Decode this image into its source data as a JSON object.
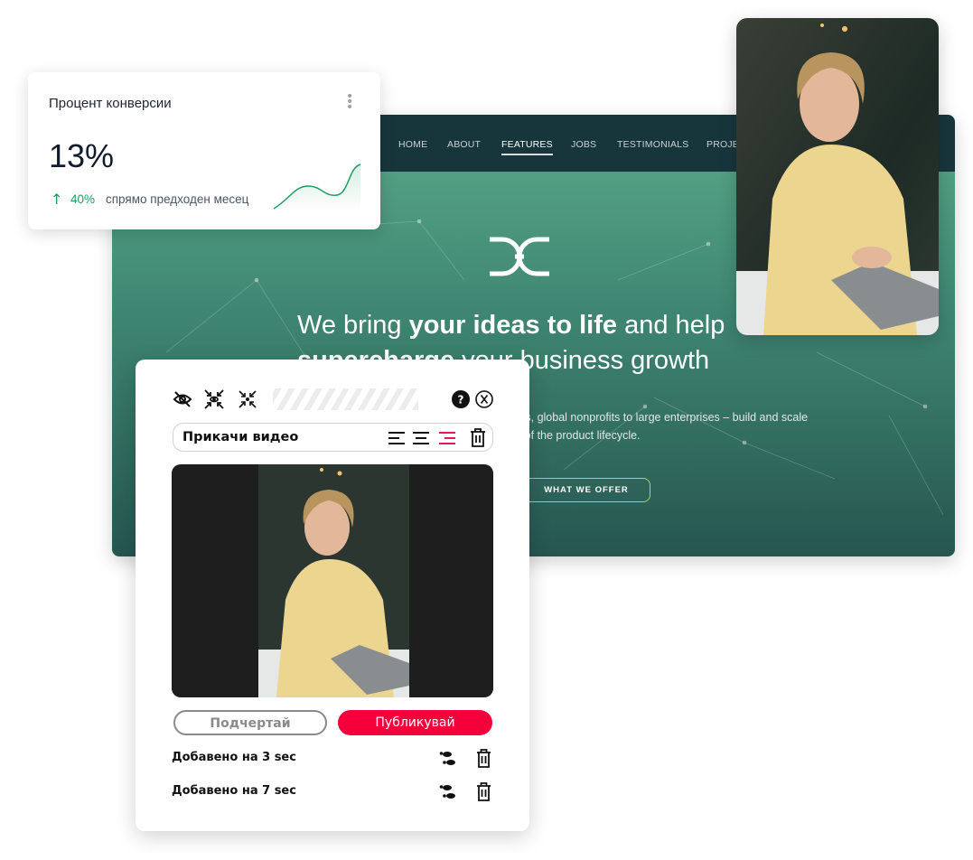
{
  "website": {
    "nav": [
      "HOME",
      "ABOUT",
      "FEATURES",
      "JOBS",
      "TESTIMONIALS",
      "PROJE"
    ],
    "active_nav": "FEATURES",
    "headline": {
      "pre": "We bring ",
      "bold1": "your ideas to life",
      "mid": " and help",
      "bold2": "supercharge",
      "post": " your business growth"
    },
    "subtext": [
      "tups, global nonprofits to large enterprises – build and scale",
      "es of the product lifecycle."
    ],
    "cta": "WHAT WE OFFER",
    "colors": {
      "nav": "#17363c",
      "hero_top": "#5aa98a",
      "hero_bottom": "#26564f"
    }
  },
  "stats_card": {
    "title": "Процент конверсии",
    "value": "13%",
    "change": "40%",
    "change_direction": "up",
    "comparison": "спрямо предходен месец",
    "accent": "#1f9d60"
  },
  "editor": {
    "toolbar_icons": [
      "eye-off-icon",
      "focus-eye-icon",
      "collapse-icon",
      "help-icon",
      "close-icon"
    ],
    "title_input": "Прикачи видео",
    "align_icons": [
      "align-left-icon",
      "align-center-icon",
      "align-right-icon",
      "trash-icon"
    ],
    "active_align": "align-right",
    "underline_button": "Подчертай",
    "publish_button": "Публикувай",
    "publish_color": "#f6003c",
    "entries": [
      {
        "label": "Добавено на 3 sec"
      },
      {
        "label": "Добавено на 7 sec"
      }
    ]
  }
}
